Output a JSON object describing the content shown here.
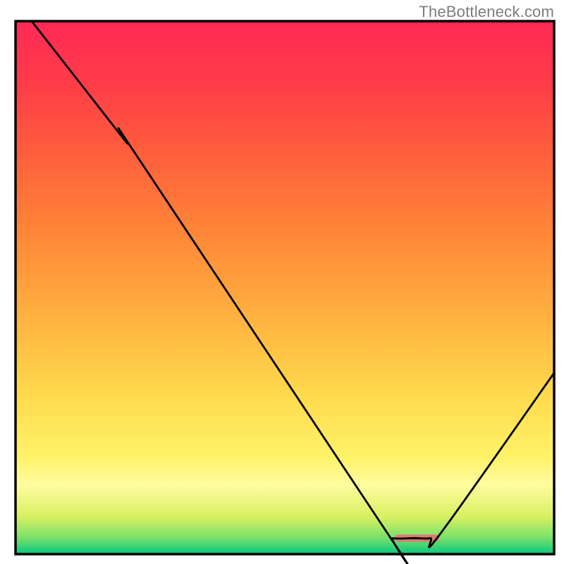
{
  "watermark": "TheBottleneck.com",
  "chart_data": {
    "type": "line",
    "title": "",
    "xlabel": "",
    "ylabel": "",
    "xlim": [
      0,
      100
    ],
    "ylim": [
      0,
      100
    ],
    "grid": false,
    "legend": false,
    "background": {
      "type": "heatmap_vertical_gradient",
      "description": "Vertical rainbow gradient suggesting bottleneck severity; green at bottom (good) through yellow/orange to red at top (bad).",
      "stops": [
        {
          "offset": 0.0,
          "color": "#04c880"
        },
        {
          "offset": 0.03,
          "color": "#77e06b"
        },
        {
          "offset": 0.07,
          "color": "#d8f061"
        },
        {
          "offset": 0.13,
          "color": "#fffca0"
        },
        {
          "offset": 0.18,
          "color": "#fff36a"
        },
        {
          "offset": 0.3,
          "color": "#ffd94c"
        },
        {
          "offset": 0.45,
          "color": "#ffb040"
        },
        {
          "offset": 0.6,
          "color": "#ff8738"
        },
        {
          "offset": 0.75,
          "color": "#ff5f3c"
        },
        {
          "offset": 0.88,
          "color": "#ff3d48"
        },
        {
          "offset": 1.0,
          "color": "#ff2955"
        }
      ]
    },
    "series": [
      {
        "name": "bottleneck-curve",
        "stroke": "#000000",
        "stroke_width": 2.8,
        "points": [
          {
            "x": 3.0,
            "y": 100.0
          },
          {
            "x": 20.0,
            "y": 78.0
          },
          {
            "x": 23.0,
            "y": 74.0
          },
          {
            "x": 69.0,
            "y": 4.0
          },
          {
            "x": 70.0,
            "y": 3.0
          },
          {
            "x": 74.0,
            "y": 3.0
          },
          {
            "x": 77.0,
            "y": 3.0
          },
          {
            "x": 79.0,
            "y": 4.0
          },
          {
            "x": 100.0,
            "y": 34.0
          }
        ]
      }
    ],
    "annotations": [
      {
        "name": "optimal-marker",
        "type": "segment",
        "x0": 71.0,
        "y0": 3.0,
        "x1": 78.0,
        "y1": 3.0,
        "stroke": "#e07878",
        "stroke_width": 10,
        "linecap": "round"
      }
    ],
    "frame": {
      "stroke": "#000000",
      "stroke_width": 3.5
    }
  }
}
